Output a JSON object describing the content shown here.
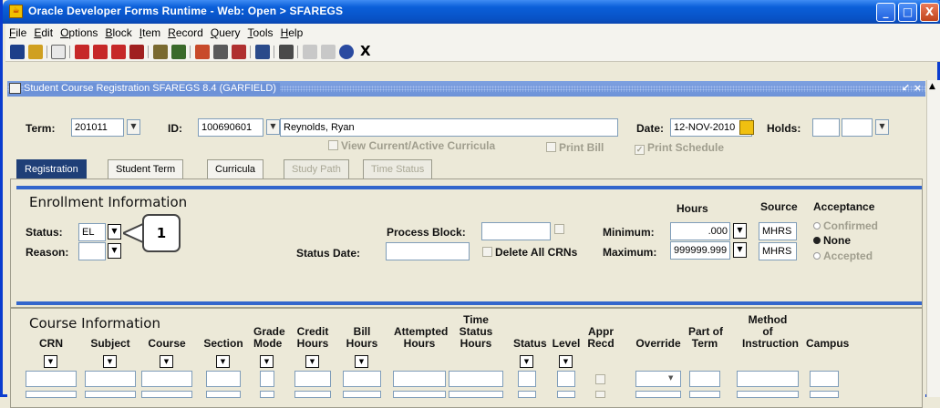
{
  "window": {
    "title": "Oracle Developer Forms Runtime - Web:  Open > SFAREGS",
    "buttons": [
      "_",
      "□",
      "X"
    ]
  },
  "menu": [
    "File",
    "Edit",
    "Options",
    "Block",
    "Item",
    "Record",
    "Query",
    "Tools",
    "Help"
  ],
  "toolbar": {
    "exit_label": "X"
  },
  "form": {
    "title": "Student Course Registration  SFAREGS  8.4  (GARFIELD)",
    "controls": "↙ ×"
  },
  "key_block": {
    "term_label": "Term:",
    "term_value": "201011",
    "id_label": "ID:",
    "id_value": "100690601",
    "name_value": "Reynolds, Ryan",
    "date_label": "Date:",
    "date_value": "12-NOV-2010",
    "holds_label": "Holds:",
    "view_curricula": "View Current/Active Curricula",
    "print_bill": "Print Bill",
    "print_schedule": "Print Schedule"
  },
  "tabs": [
    "Registration",
    "Student Term",
    "Curricula",
    "Study Path",
    "Time Status"
  ],
  "enrollment": {
    "title": "Enrollment Information",
    "status_label": "Status:",
    "status_value": "EL",
    "reason_label": "Reason:",
    "process_block_label": "Process Block:",
    "status_date_label": "Status Date:",
    "delete_all_crns": "Delete All CRNs",
    "hours_header": "Hours",
    "source_header": "Source",
    "acceptance_header": "Acceptance",
    "minimum_label": "Minimum:",
    "minimum_value": ".000",
    "minimum_source": "MHRS",
    "maximum_label": "Maximum:",
    "maximum_value": "999999.999",
    "maximum_source": "MHRS",
    "acceptance_options": [
      {
        "label": "Confirmed",
        "selected": false
      },
      {
        "label": "None",
        "selected": true
      },
      {
        "label": "Accepted",
        "selected": false
      }
    ]
  },
  "callout": {
    "number": "1"
  },
  "course": {
    "title": "Course Information",
    "columns": [
      {
        "top": "",
        "mid": "",
        "bot": "CRN"
      },
      {
        "top": "",
        "mid": "",
        "bot": "Subject"
      },
      {
        "top": "",
        "mid": "",
        "bot": "Course"
      },
      {
        "top": "",
        "mid": "",
        "bot": "Section"
      },
      {
        "top": "",
        "mid": "Grade",
        "bot": "Mode"
      },
      {
        "top": "",
        "mid": "Credit",
        "bot": "Hours"
      },
      {
        "top": "",
        "mid": "Bill",
        "bot": "Hours"
      },
      {
        "top": "",
        "mid": "Attempted",
        "bot": "Hours"
      },
      {
        "top": "Time",
        "mid": "Status",
        "bot": "Hours"
      },
      {
        "top": "",
        "mid": "",
        "bot": "Status"
      },
      {
        "top": "",
        "mid": "",
        "bot": "Level"
      },
      {
        "top": "",
        "mid": "Appr",
        "bot": "Recd"
      },
      {
        "top": "",
        "mid": "",
        "bot": "Override"
      },
      {
        "top": "",
        "mid": "Part of",
        "bot": "Term"
      },
      {
        "top": "Method",
        "mid": "of",
        "bot": "Instruction"
      },
      {
        "top": "",
        "mid": "",
        "bot": "Campus"
      }
    ]
  }
}
